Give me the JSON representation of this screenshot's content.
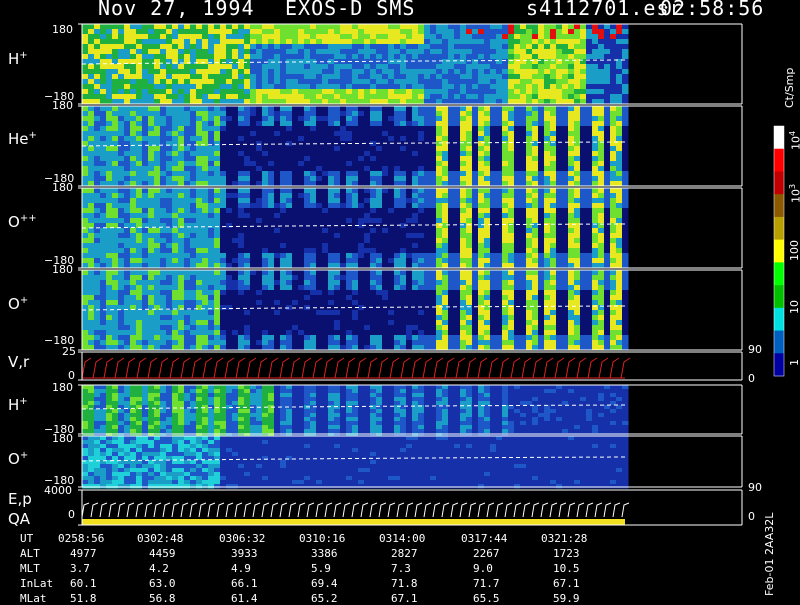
{
  "header": {
    "date": "Nov 27, 1994",
    "instrument": "EXOS-D SMS",
    "file": "s4112701.esr",
    "time": "02:58:56"
  },
  "panels": [
    {
      "label": "H",
      "sup": "+",
      "ymax": "180",
      "ymin": "−180"
    },
    {
      "label": "He",
      "sup": "+",
      "ymax": "180",
      "ymin": "−180"
    },
    {
      "label": "O",
      "sup": "++",
      "ymax": "180",
      "ymin": "−180"
    },
    {
      "label": "O",
      "sup": "+",
      "ymax": "180",
      "ymin": "−180"
    },
    {
      "label": "V,r",
      "sup": "",
      "ymax": "25",
      "ymin": "0",
      "ymax_r": "90",
      "ymin_r": "0"
    },
    {
      "label": "H",
      "sup": "+",
      "ymax": "180",
      "ymin": "−180"
    },
    {
      "label": "O",
      "sup": "+",
      "ymax": "180",
      "ymin": "−180"
    },
    {
      "label": "E,p",
      "label2": "QA",
      "sup": "",
      "ymax": "4000",
      "ymin": "0",
      "ymax_r": "90",
      "ymin_r": "0"
    }
  ],
  "colorbar": {
    "unit": "Ct/Smp",
    "ticks": [
      {
        "text": "10",
        "sup": "4"
      },
      {
        "text": "10",
        "sup": "3"
      },
      {
        "text": "100",
        "sup": ""
      },
      {
        "text": "10",
        "sup": ""
      },
      {
        "text": "1",
        "sup": ""
      }
    ],
    "colors": [
      "#ffffff",
      "#ff0000",
      "#c00000",
      "#8b5a00",
      "#b8a000",
      "#ffff00",
      "#00ff00",
      "#00c000",
      "#00e0e0",
      "#0060c0",
      "#0000a0"
    ]
  },
  "footer": {
    "rows": [
      {
        "name": "UT",
        "values": [
          "0258:56",
          "0302:48",
          "0306:32",
          "0310:16",
          "0314:00",
          "0317:44",
          "0321:28"
        ]
      },
      {
        "name": "ALT",
        "values": [
          "4977",
          "4459",
          "3933",
          "3386",
          "2827",
          "2267",
          "1723"
        ]
      },
      {
        "name": "MLT",
        "values": [
          "3.7",
          "4.2",
          "4.9",
          "5.9",
          "7.3",
          "9.0",
          "10.5"
        ]
      },
      {
        "name": "InLat",
        "values": [
          "60.1",
          "63.0",
          "66.1",
          "69.4",
          "71.8",
          "71.7",
          "67.1"
        ]
      },
      {
        "name": "MLat",
        "values": [
          "51.8",
          "56.8",
          "61.4",
          "65.2",
          "67.1",
          "65.5",
          "59.9"
        ]
      }
    ],
    "version": "Feb-01 2AA32L"
  },
  "chart_data": {
    "type": "heatmap",
    "title": "Nov 27, 1994   EXOS-D SMS",
    "x_ticks": [
      "0258:56",
      "0302:48",
      "0306:32",
      "0310:16",
      "0314:00",
      "0317:44",
      "0321:28"
    ],
    "panels": [
      {
        "label": "H+",
        "ylim": [
          -180,
          180
        ]
      },
      {
        "label": "He+",
        "ylim": [
          -180,
          180
        ]
      },
      {
        "label": "O++",
        "ylim": [
          -180,
          180
        ]
      },
      {
        "label": "O+",
        "ylim": [
          -180,
          180
        ]
      },
      {
        "label": "V,r",
        "ylim": [
          0,
          25
        ],
        "ylim_right": [
          0,
          90
        ]
      },
      {
        "label": "H+",
        "ylim": [
          -180,
          180
        ]
      },
      {
        "label": "O+",
        "ylim": [
          -180,
          180
        ]
      },
      {
        "label": "E,p",
        "ylim": [
          0,
          4000
        ],
        "ylim_right": [
          0,
          90
        ]
      }
    ],
    "colorbar": {
      "unit": "Ct/Smp",
      "scale": "log",
      "range": [
        1,
        10000
      ]
    }
  }
}
